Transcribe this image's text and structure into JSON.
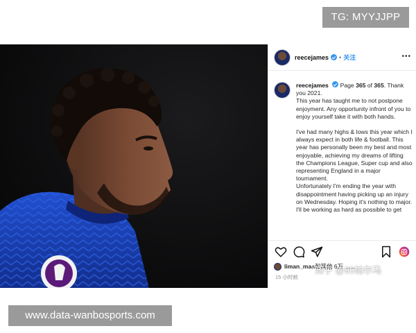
{
  "top_badge": {
    "text": "TG: MYYJJPP"
  },
  "post": {
    "username": "reecejames",
    "follow_label": "关注",
    "caption": {
      "username": "reecejames",
      "line_1_pre": "Page ",
      "page_current": "365",
      "line_1_mid": " of ",
      "page_total": "365",
      "line_1_post": ". Thank you 2021.",
      "paragraph_1": "This year has taught me to not postpone enjoyment. Any opportunity infront of you to enjoy yourself take it with both hands.",
      "paragraph_2": "I've had many highs & lows this year which I always expect in both life & football. This year has personally been my best and most enjoyable, achieving my dreams of lifting the Champions League, Super cup and also representing England in a major tournament.",
      "paragraph_3": "Unfortunately I'm ending the year with disappointment having picking up an injury on Wednesday. Hoping it's nothing to major.",
      "paragraph_4": "I'll be working as hard as possible to get"
    },
    "actions": {
      "like": "heart-icon",
      "comment": "comment-icon",
      "share": "send-icon",
      "save": "bookmark-icon"
    },
    "likes_user": "liman_ma",
    "likes_rest": "a和其他 6万 ......",
    "timestamp": "15 小时前"
  },
  "watermark": {
    "text": "知乎 @95帕尔马"
  },
  "site_badge": {
    "text": "www.data-wanbosports.com"
  },
  "colors": {
    "accent_blue": "#3897f0",
    "badge_gray": "#9a9a9a",
    "kit_blue": "#1a3fa8"
  }
}
